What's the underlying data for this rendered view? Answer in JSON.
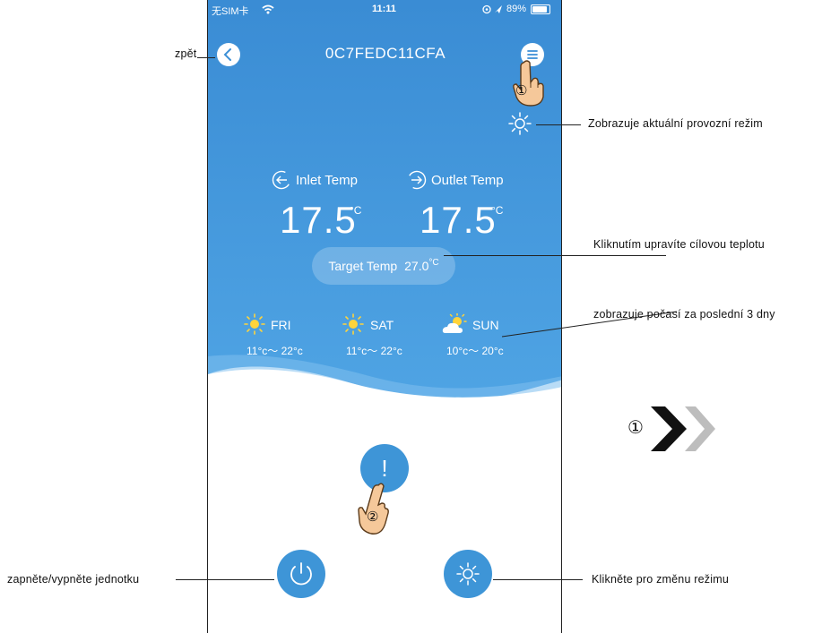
{
  "status_bar": {
    "carrier": "无SIM卡",
    "time": "11:11",
    "battery": "89%"
  },
  "header": {
    "title": "0C7FEDC11CFA"
  },
  "temps": {
    "inlet_label": "Inlet Temp",
    "inlet_value": "17.5",
    "outlet_label": "Outlet Temp",
    "outlet_value": "17.5",
    "unit": "°C",
    "target_label": "Target Temp",
    "target_value": "27.0",
    "target_unit": "°C"
  },
  "weather": [
    {
      "day": "FRI",
      "range": "11°c～ 22°c",
      "icon": "sun-icon"
    },
    {
      "day": "SAT",
      "range": "11°c～ 22°c",
      "icon": "sun-icon"
    },
    {
      "day": "SUN",
      "range": "10°c～ 20°c",
      "icon": "partly-cloudy-icon"
    }
  ],
  "center_button": {
    "symbol": "!"
  },
  "callouts": {
    "back": "zpět",
    "mode_display": "Zobrazuje aktuální provozní režim",
    "target_temp": "Kliknutím upravíte cílovou teplotu",
    "weather": "zobrazuje počasí za poslední 3 dny",
    "power": "zapněte/vypněte jednotku",
    "mode_change": "Klikněte pro změnu režimu"
  },
  "step_markers": {
    "one": "①",
    "two": "②"
  },
  "colors": {
    "sky_top": "#3b8fd6",
    "sky_bottom": "#4da3e3",
    "button_blue": "#3e95d7",
    "hand": "#f5c89a"
  }
}
